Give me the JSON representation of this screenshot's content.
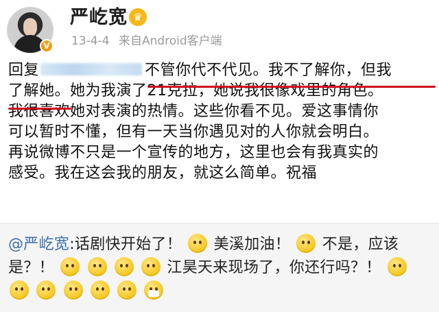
{
  "header": {
    "username": "严屹宽",
    "date": "13-4-4",
    "source": "来自Android客户端",
    "verified_badge": "V",
    "crown": "♛"
  },
  "post": {
    "lines": [
      {
        "prefix": "回复",
        "text": "不管你代不代见。我不了解你，但我"
      },
      {
        "text": "了解她。她为我演了21克拉，她说我很像戏里的角色。"
      },
      {
        "text": "我很喜欢她对表演的热情。这些你看不见。爱这事情你"
      },
      {
        "text": "可以暂时不懂，但有一天当你遇见对的人你就会明白。"
      },
      {
        "text": "再说微博不只是一个宣传的地方，这里也会有我真实的"
      },
      {
        "text": "感受。我在这会我的朋友，就这么简单。祝福"
      }
    ]
  },
  "comment": {
    "mention": "@严屹宽",
    "part1": ":话剧快开始了！",
    "part2": "美溪加油！",
    "part3": "不是，应该",
    "part4": "是？！",
    "part5": "江昊天来现场了，你还行吗？！"
  },
  "colors": {
    "underline": "#d0021b",
    "mention": "#3a6ea8",
    "meta": "#9a9a9a"
  }
}
